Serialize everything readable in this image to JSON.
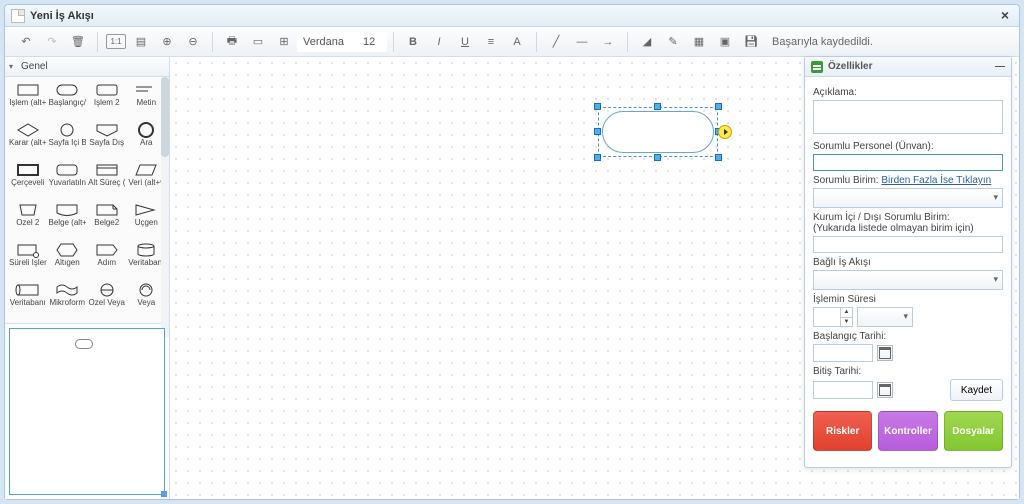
{
  "window": {
    "title": "Yeni İş Akışı"
  },
  "toolbar": {
    "font": "Verdana",
    "size": "12",
    "status": "Başarıyla kaydedildi."
  },
  "sidebar": {
    "category": "Genel",
    "shapes": [
      {
        "label": "İşlem (alt+"
      },
      {
        "label": "Başlangıç/"
      },
      {
        "label": "İşlem 2"
      },
      {
        "label": "Metin"
      },
      {
        "label": "Karar (alt+"
      },
      {
        "label": "Sayfa İçi B"
      },
      {
        "label": "Sayfa Dış"
      },
      {
        "label": "Ara"
      },
      {
        "label": "Çerçeveli"
      },
      {
        "label": "Yuvarlatıln"
      },
      {
        "label": "Alt Süreç ("
      },
      {
        "label": "Veri (alt+v"
      },
      {
        "label": "Özel 2"
      },
      {
        "label": "Belge (alt+"
      },
      {
        "label": "Belge2"
      },
      {
        "label": "Üçgen"
      },
      {
        "label": "Süreli İşler"
      },
      {
        "label": "Altıgen"
      },
      {
        "label": "Adım"
      },
      {
        "label": "Veritabanı"
      },
      {
        "label": "Veritabanı"
      },
      {
        "label": "Mikroform"
      },
      {
        "label": "Özel Veya"
      },
      {
        "label": "Veya"
      }
    ]
  },
  "props": {
    "title": "Özellikler",
    "labels": {
      "aciklama": "Açıklama:",
      "sorumlu_personel": "Sorumlu Personel (Ünvan):",
      "sorumlu_birim_pre": "Sorumlu Birim: ",
      "sorumlu_birim_link": "Birden Fazla İse Tıklayın",
      "kurum_ici_l1": "Kurum İçi / Dışı Sorumlu Birim:",
      "kurum_ici_l2": "(Yukarıda listede olmayan birim için)",
      "bagli": "Bağlı İş Akışı",
      "islem_suresi": "İşlemin Süresi",
      "baslangic": "Başlangıç Tarihi:",
      "bitis": "Bitiş Tarihi:",
      "kaydet": "Kaydet",
      "riskler": "Riskler",
      "kontroller": "Kontroller",
      "dosyalar": "Dosyalar"
    },
    "values": {
      "aciklama": "",
      "sorumlu_personel": "",
      "sorumlu_birim": "",
      "kurum_ici": "",
      "bagli": "",
      "sure_val": "",
      "sure_unit": "",
      "baslangic": "",
      "bitis": ""
    }
  }
}
